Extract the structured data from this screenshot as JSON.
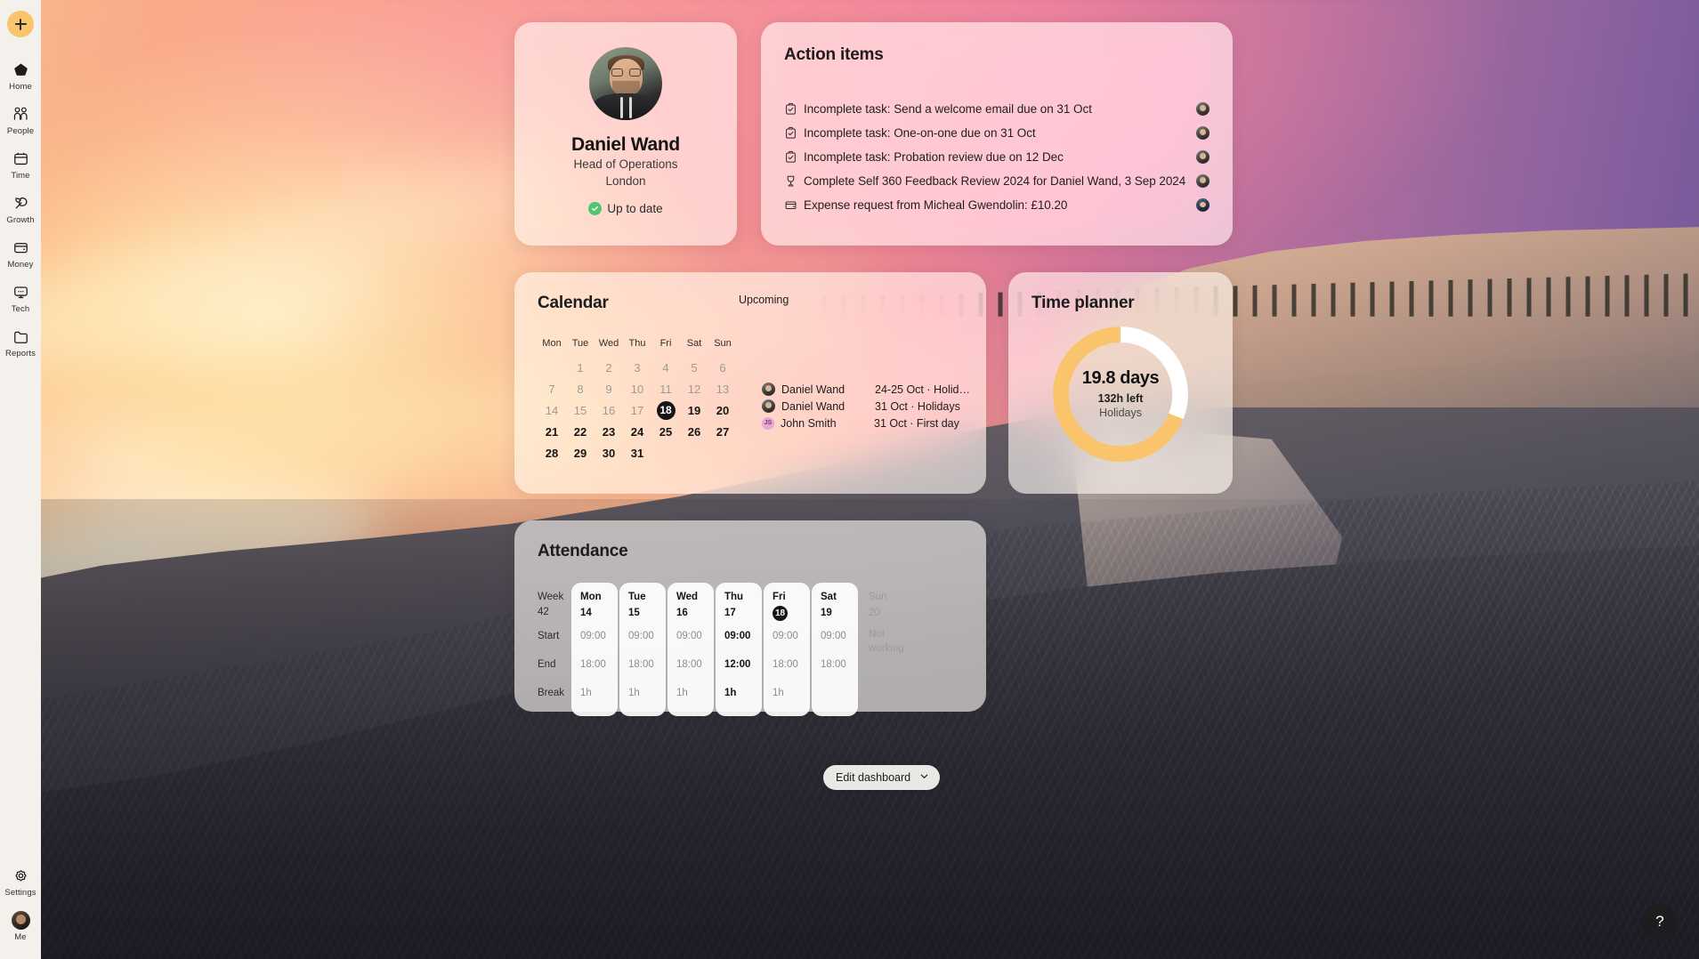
{
  "sidebar": {
    "add_button": "+",
    "items": [
      {
        "label": "Home",
        "icon": "home-icon"
      },
      {
        "label": "People",
        "icon": "people-icon"
      },
      {
        "label": "Time",
        "icon": "calendar-icon"
      },
      {
        "label": "Growth",
        "icon": "leaf-icon"
      },
      {
        "label": "Money",
        "icon": "wallet-icon"
      },
      {
        "label": "Tech",
        "icon": "monitor-icon"
      },
      {
        "label": "Reports",
        "icon": "folder-icon"
      }
    ],
    "bottom": [
      {
        "label": "Settings",
        "icon": "gear-icon"
      },
      {
        "label": "Me",
        "icon": "avatar-icon"
      }
    ]
  },
  "profile": {
    "name": "Daniel Wand",
    "role": "Head of Operations",
    "location": "London",
    "status": "Up to date",
    "status_color": "#4fc66f"
  },
  "action_items": {
    "title": "Action items",
    "rows": [
      {
        "icon": "clipboard-check-icon",
        "text": "Incomplete task: Send a welcome email due on 31 Oct",
        "avatar": "daniel"
      },
      {
        "icon": "clipboard-check-icon",
        "text": "Incomplete task: One-on-one due on 31 Oct",
        "avatar": "daniel"
      },
      {
        "icon": "clipboard-check-icon",
        "text": "Incomplete task: Probation review due on 12 Dec",
        "avatar": "daniel"
      },
      {
        "icon": "trophy-icon",
        "text": "Complete Self 360 Feedback Review 2024 for Daniel Wand, 3 Sep 2024",
        "avatar": "daniel"
      },
      {
        "icon": "wallet-icon",
        "text": "Expense request from Micheal Gwendolin: £10.20",
        "avatar": "micheal"
      }
    ]
  },
  "calendar": {
    "title": "Calendar",
    "dow": [
      "Mon",
      "Tue",
      "Wed",
      "Thu",
      "Fri",
      "Sat",
      "Sun"
    ],
    "today": 18,
    "cells": [
      {
        "d": "",
        "muted": true
      },
      {
        "d": "1",
        "muted": true
      },
      {
        "d": "2",
        "muted": true
      },
      {
        "d": "3",
        "muted": true
      },
      {
        "d": "4",
        "muted": true
      },
      {
        "d": "5",
        "muted": true
      },
      {
        "d": "6",
        "muted": true
      },
      {
        "d": "7",
        "muted": true
      },
      {
        "d": "8",
        "muted": true
      },
      {
        "d": "9",
        "muted": true
      },
      {
        "d": "10",
        "muted": true
      },
      {
        "d": "11",
        "muted": true
      },
      {
        "d": "12",
        "muted": true
      },
      {
        "d": "13",
        "muted": true
      },
      {
        "d": "14",
        "muted": true
      },
      {
        "d": "15",
        "muted": true
      },
      {
        "d": "16",
        "muted": true
      },
      {
        "d": "17",
        "muted": true
      },
      {
        "d": "18",
        "muted": false,
        "today": true
      },
      {
        "d": "19",
        "muted": false
      },
      {
        "d": "20",
        "muted": false
      },
      {
        "d": "21",
        "muted": false
      },
      {
        "d": "22",
        "muted": false
      },
      {
        "d": "23",
        "muted": false
      },
      {
        "d": "24",
        "muted": false
      },
      {
        "d": "25",
        "muted": false
      },
      {
        "d": "26",
        "muted": false
      },
      {
        "d": "27",
        "muted": false
      },
      {
        "d": "28",
        "muted": false
      },
      {
        "d": "29",
        "muted": false
      },
      {
        "d": "30",
        "muted": false
      },
      {
        "d": "31",
        "muted": false
      },
      {
        "d": "",
        "muted": true
      },
      {
        "d": "",
        "muted": true
      },
      {
        "d": "",
        "muted": true
      }
    ]
  },
  "upcoming": {
    "title": "Upcoming",
    "rows": [
      {
        "name": "Daniel Wand",
        "detail": "24-25 Oct · Holid…",
        "avatar": "daniel"
      },
      {
        "name": "Daniel Wand",
        "detail": "31 Oct · Holidays",
        "avatar": "daniel"
      },
      {
        "name": "John Smith",
        "detail": "31 Oct · First day",
        "avatar": "initials",
        "initials": "JS"
      }
    ]
  },
  "time_planner": {
    "title": "Time planner",
    "days": "19.8 days",
    "hours_left": "132h left",
    "category": "Holidays",
    "arc_color": "#f9c46b",
    "track_color": "#ffffff"
  },
  "chart_data": {
    "type": "pie",
    "title": "Time planner",
    "labels": [
      "Holidays used",
      "Holidays remaining"
    ],
    "values": [
      69,
      31
    ],
    "unit": "%",
    "center_label": "19.8 days",
    "center_sublabel": "132h left",
    "center_caption": "Holidays",
    "colors": [
      "#f9c46b",
      "#ffffff"
    ],
    "legend": "none",
    "donut": true
  },
  "attendance": {
    "title": "Attendance",
    "row_labels": [
      "Week",
      "42",
      "Start",
      "End",
      "Break"
    ],
    "label_week": "Week",
    "label_week_num": "42",
    "label_start": "Start",
    "label_end": "End",
    "label_break": "Break",
    "columns": [
      {
        "dow": "Mon",
        "day": "14",
        "start": "09:00",
        "end": "18:00",
        "break": "1h",
        "today": false,
        "working": true
      },
      {
        "dow": "Tue",
        "day": "15",
        "start": "09:00",
        "end": "18:00",
        "break": "1h",
        "today": false,
        "working": true
      },
      {
        "dow": "Wed",
        "day": "16",
        "start": "09:00",
        "end": "18:00",
        "break": "1h",
        "today": false,
        "working": true
      },
      {
        "dow": "Thu",
        "day": "17",
        "start": "09:00",
        "end": "12:00",
        "break": "1h",
        "today": false,
        "working": true,
        "highlight": true
      },
      {
        "dow": "Fri",
        "day": "18",
        "start": "09:00",
        "end": "18:00",
        "break": "1h",
        "today": true,
        "working": true
      },
      {
        "dow": "Sat",
        "day": "19",
        "start": "09:00",
        "end": "18:00",
        "break": "",
        "today": false,
        "working": true
      },
      {
        "dow": "Sun",
        "day": "20",
        "off_text": "Not working",
        "today": false,
        "working": false
      }
    ]
  },
  "footer": {
    "edit_dashboard": "Edit dashboard",
    "help": "?"
  }
}
